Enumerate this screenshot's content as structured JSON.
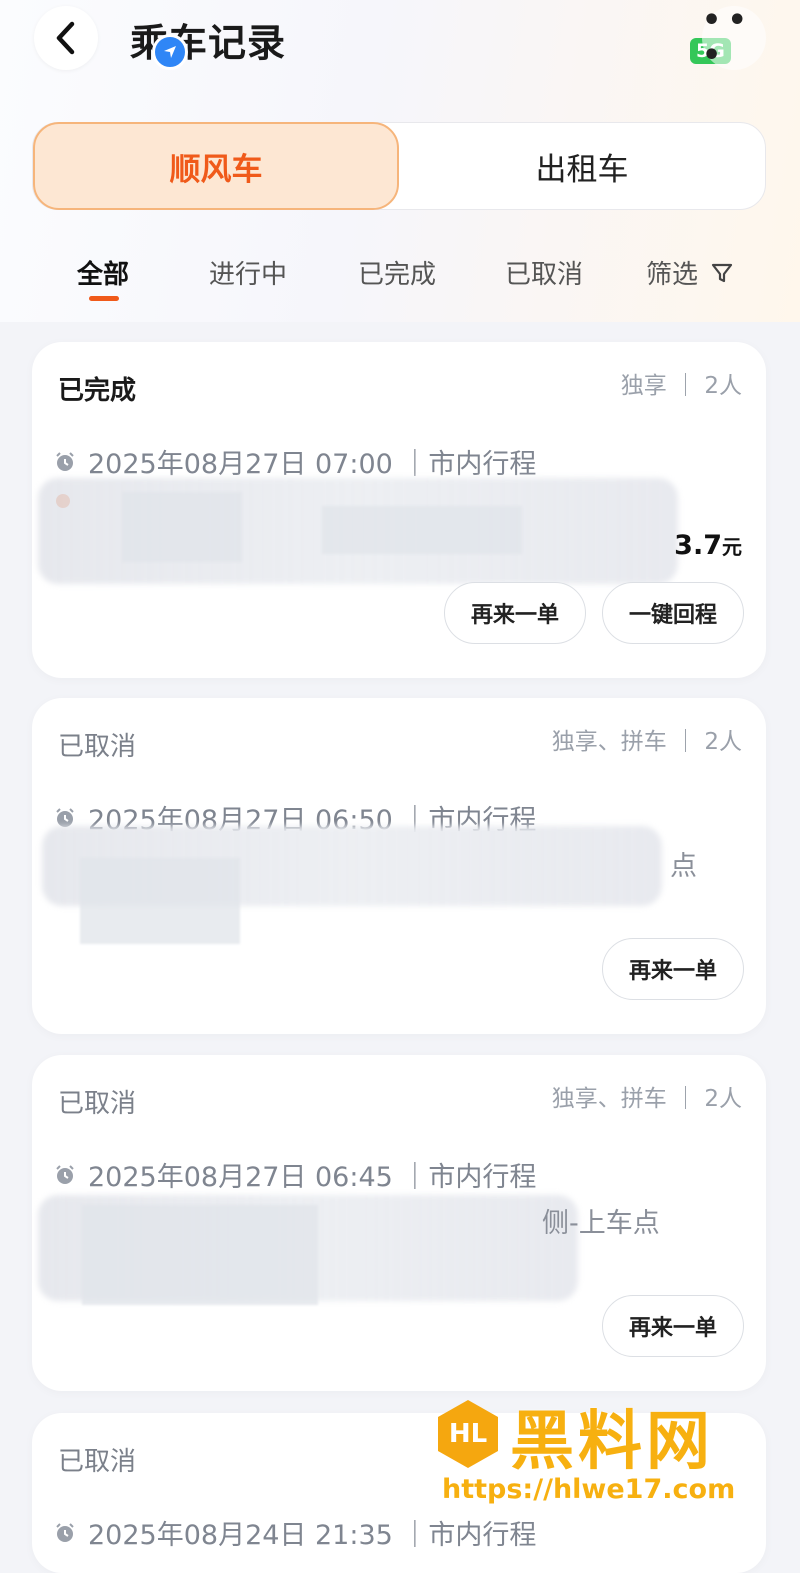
{
  "header": {
    "title": "乘车记录",
    "signal": "5G"
  },
  "segments": {
    "active": "顺风车",
    "other": "出租车"
  },
  "tabs": [
    "全部",
    "进行中",
    "已完成",
    "已取消",
    "筛选"
  ],
  "cards": [
    {
      "status": "已完成",
      "meta": "独享 ｜ 2人",
      "time": "2025年08月27日 07:00 ｜市内行程",
      "price_value": "3.7",
      "price_unit": "元",
      "buttons": [
        "再来一单",
        "一键回程"
      ]
    },
    {
      "status": "已取消",
      "meta": "独享、拼车 ｜ 2人",
      "time": "2025年08月27日 06:50 ｜市内行程",
      "tail": "点",
      "buttons": [
        "再来一单"
      ]
    },
    {
      "status": "已取消",
      "meta": "独享、拼车 ｜ 2人",
      "time": "2025年08月27日 06:45 ｜市内行程",
      "tail": "侧-上车点",
      "buttons": [
        "再来一单"
      ]
    },
    {
      "status": "已取消",
      "time": "2025年08月24日 21:35 ｜市内行程"
    }
  ],
  "watermark": {
    "logo": "HL",
    "text": "黑料网",
    "url": "https://hlwe17.com"
  }
}
